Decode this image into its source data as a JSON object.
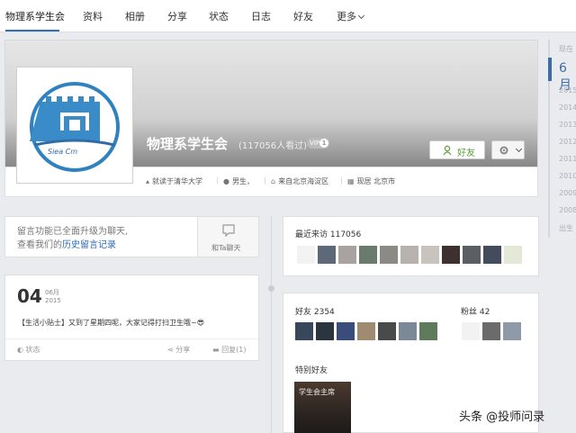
{
  "nav": {
    "items": [
      "物理系学生会",
      "资料",
      "相册",
      "分享",
      "状态",
      "日志",
      "好友",
      "更多"
    ]
  },
  "profile": {
    "name": "物理系学生会",
    "views": "(117056人看过)",
    "vip": "VIP",
    "vip_level": "1",
    "friend_button": "好友",
    "info": {
      "school": "就读于清华大学",
      "gender": "男生，",
      "hometown": "来自北京海淀区",
      "residence": "现居 北京市"
    }
  },
  "message": {
    "line1": "留言功能已全面升级为聊天,",
    "line2_prefix": "查看我们的",
    "line2_link": "历史留言记录",
    "chat_label": "和Ta聊天"
  },
  "post": {
    "day": "04",
    "month": "06月",
    "year": "2015",
    "text": "【生活小贴士】又到了星期四呢，大家记得打扫卫生哦~😎",
    "status": "状态",
    "share": "分享",
    "reply": "回复(1)"
  },
  "visitors": {
    "title": "最近来访 117056"
  },
  "friends": {
    "title": "好友 2354",
    "fans": "粉丝 42",
    "special": "特别好友",
    "special_name": "学生会主席"
  },
  "timeline": {
    "items": [
      "现在",
      "6月",
      "2015",
      "2014",
      "2013",
      "2012",
      "2011",
      "2010",
      "2009",
      "2008",
      "出生"
    ]
  },
  "watermark": "头条 @投师问录",
  "colors": {
    "accent": "#2e6fb8",
    "timeline": "#3d6aa8",
    "friend_green": "#5a9e3a"
  }
}
